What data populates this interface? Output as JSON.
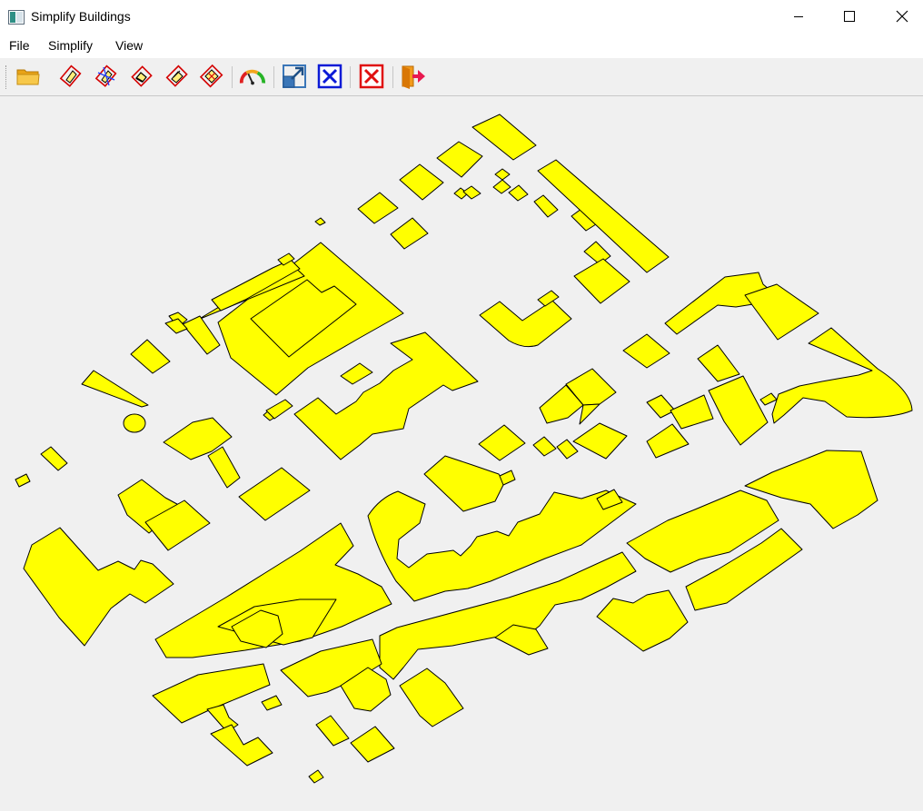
{
  "window": {
    "title": "Simplify Buildings",
    "icon": "app-window-icon",
    "controls": [
      "minimize-icon",
      "maximize-icon",
      "close-icon"
    ]
  },
  "menu": {
    "file": "File",
    "simplify": "Simplify",
    "view": "View"
  },
  "toolbar": {
    "items": [
      "open-folder-icon",
      "simplify-mbr-icon",
      "simplify-wall-average-icon",
      "simplify-longest-edge-icon",
      "simplify-wall-weighted-icon",
      "simplify-pca-icon",
      "evaluate-gauge-icon",
      "export-results-icon",
      "clear-results-icon",
      "clear-all-icon",
      "exit-icon"
    ]
  },
  "canvas": {
    "background": "#f0f0f0",
    "building_fill": "#ffff00",
    "building_stroke": "#000000"
  }
}
